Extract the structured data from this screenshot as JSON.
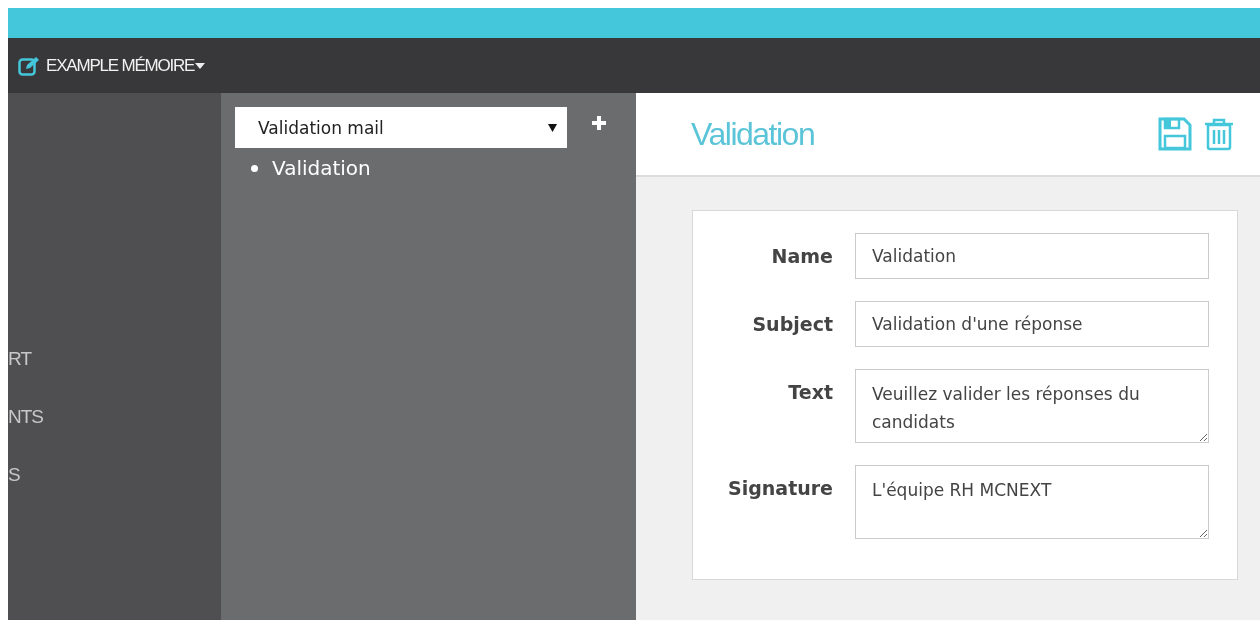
{
  "navbar": {
    "title": "EXAMPLE MÉMOIRE"
  },
  "sidebar": {
    "items": [
      {
        "label": "RT"
      },
      {
        "label": "NTS"
      },
      {
        "label": "S"
      }
    ]
  },
  "template_panel": {
    "select": {
      "value": "Validation mail"
    },
    "items": [
      {
        "label": "Validation"
      }
    ]
  },
  "editor": {
    "title": "Validation",
    "fields": [
      {
        "label": "Name",
        "kind": "input",
        "value": "Validation"
      },
      {
        "label": "Subject",
        "kind": "input",
        "value": "Validation d'une réponse"
      },
      {
        "label": "Text",
        "kind": "textarea",
        "value": "Veuillez valider les réponses du candidats"
      },
      {
        "label": "Signature",
        "kind": "textarea",
        "value": "L'équipe RH MCNEXT"
      }
    ]
  }
}
